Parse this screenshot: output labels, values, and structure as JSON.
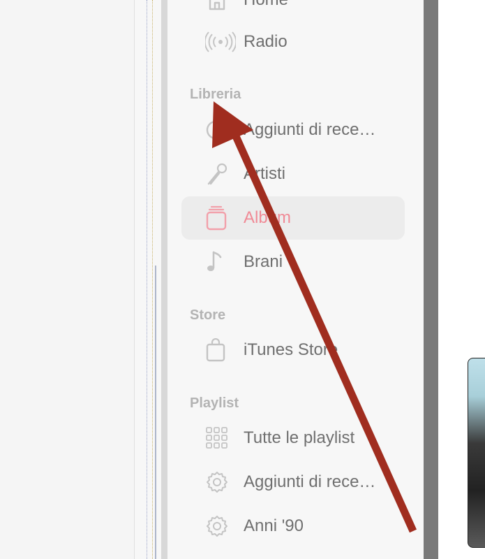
{
  "colors": {
    "accent": "#f08a96",
    "annotation_arrow": "#a02d1f",
    "section_header": "#b3b3b3",
    "item_text": "#6f6f6f"
  },
  "sidebar": {
    "top_items": [
      {
        "label": "Home",
        "icon": "home-icon"
      },
      {
        "label": "Radio",
        "icon": "radio-icon"
      }
    ],
    "sections": [
      {
        "title": "Libreria",
        "items": [
          {
            "label": "Aggiunti di rece…",
            "icon": "clock-icon",
            "selected": false
          },
          {
            "label": "Artisti",
            "icon": "microphone-icon",
            "selected": false
          },
          {
            "label": "Album",
            "icon": "album-icon",
            "selected": true
          },
          {
            "label": "Brani",
            "icon": "music-note-icon",
            "selected": false
          }
        ]
      },
      {
        "title": "Store",
        "items": [
          {
            "label": "iTunes Store",
            "icon": "shopping-bag-icon",
            "selected": false
          }
        ]
      },
      {
        "title": "Playlist",
        "items": [
          {
            "label": "Tutte le playlist",
            "icon": "grid-icon",
            "selected": false
          },
          {
            "label": "Aggiunti di rece…",
            "icon": "smart-playlist-gear-icon",
            "selected": false
          },
          {
            "label": "Anni '90",
            "icon": "smart-playlist-gear-icon",
            "selected": false
          }
        ]
      }
    ]
  }
}
